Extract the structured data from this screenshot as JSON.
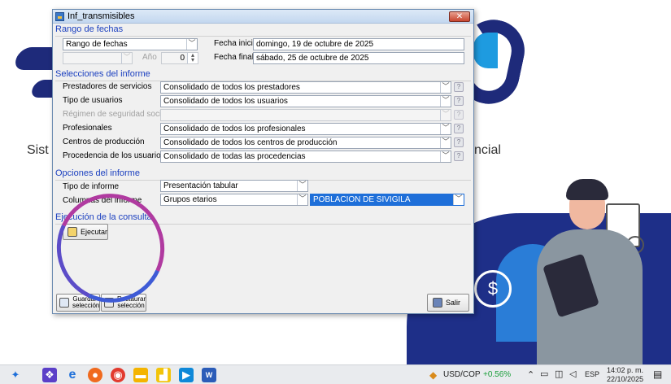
{
  "desktop": {
    "left_text": "Sist",
    "right_text": "ncial"
  },
  "window": {
    "title": "Inf_transmisibles",
    "close_glyph": "✕"
  },
  "date_range": {
    "section_label": "Rango de fechas",
    "range_type": "Rango de fechas",
    "secondary_select": "",
    "year_label": "Año",
    "year_value": "0",
    "start_label": "Fecha inicial",
    "start_value": "domingo, 19 de octubre de 2025",
    "end_label": "Fecha final",
    "end_value": "sábado, 25 de octubre de 2025"
  },
  "selections": {
    "section_label": "Selecciones del informe",
    "rows": [
      {
        "label": "Prestadores de servicios",
        "value": "Consolidado de todos los prestadores",
        "disabled": false
      },
      {
        "label": "Tipo de usuarios",
        "value": "Consolidado de todos los usuarios",
        "disabled": false
      },
      {
        "label": "Régimen de seguridad social",
        "value": "",
        "disabled": true
      },
      {
        "label": "Profesionales",
        "value": "Consolidado de todos los profesionales",
        "disabled": false
      },
      {
        "label": "Centros de producción",
        "value": "Consolidado de todos los centros de producción",
        "disabled": false
      },
      {
        "label": "Procedencia de los usuarios",
        "value": "Consolidado de todas las procedencias",
        "disabled": false
      }
    ]
  },
  "report_options": {
    "section_label": "Opciones del informe",
    "type_label": "Tipo de informe",
    "type_value": "Presentación tabular",
    "columns_label": "Columnas del informe",
    "columns_value": "Grupos etarios",
    "filter_value": "POBLACION DE SIVIGILA"
  },
  "execution": {
    "section_label": "Ejecución de la consulta",
    "run_label": "Ejecutar"
  },
  "footer": {
    "save_label": "Guardar selección",
    "restore_label": "Restaurar selección",
    "exit_label": "Salir"
  },
  "taskbar": {
    "ticker": "USD/COP",
    "change": "+0.56%",
    "lang": "ESP",
    "time": "14:02 p. m.",
    "date": "22/10/2025",
    "colors": {
      "up": "#1a9e3a",
      "accent": "#1e6fd9"
    }
  }
}
